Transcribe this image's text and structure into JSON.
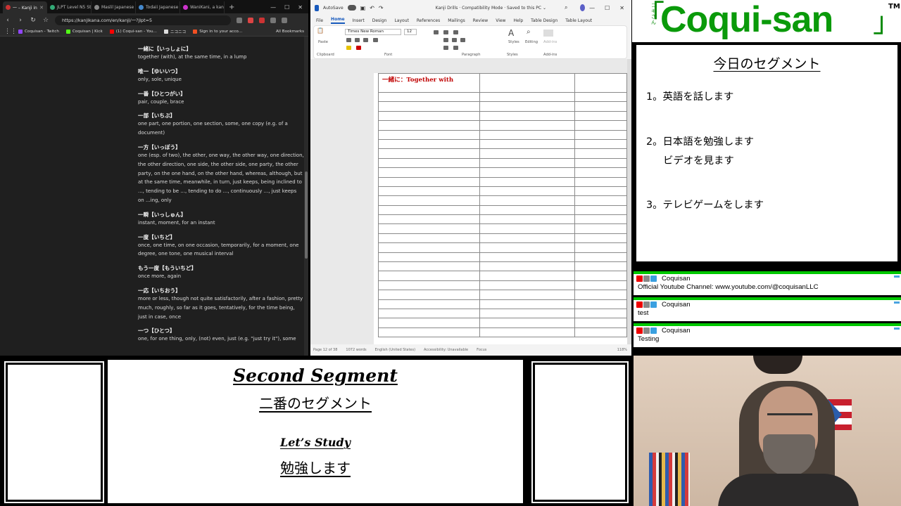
{
  "browser": {
    "tabs": [
      {
        "label": "一 – Kanji in"
      },
      {
        "label": "JLPT Level N5 St"
      },
      {
        "label": "Maslil Japanese"
      },
      {
        "label": "Todaii Japanese"
      },
      {
        "label": "WaniKani, a kan"
      }
    ],
    "url": "https://kanjikana.com/en/kanji/一?jlpt=5",
    "bookmarks": [
      {
        "label": "Coquisan - Twitch"
      },
      {
        "label": "Coquisan | Kick"
      },
      {
        "label": "(1) Coqui-san - You..."
      },
      {
        "label": "ニコニコ"
      },
      {
        "label": "Sign in to your acco..."
      }
    ],
    "all_bookmarks": "All Bookmarks",
    "entries": [
      {
        "word": "一緒に【いっしょに】",
        "meaning": "together (with), at the same time, in a lump"
      },
      {
        "word": "唯一【ゆいいつ】",
        "meaning": "only, sole, unique"
      },
      {
        "word": "一番【ひとつがい】",
        "meaning": "pair, couple, brace"
      },
      {
        "word": "一部【いちぶ】",
        "meaning": "one part, one portion, one section, some, one copy (e.g. of a document)"
      },
      {
        "word": "一方【いっぽう】",
        "meaning": "one (esp. of two), the other, one way, the other way, one direction, the other direction, one side, the other side, one party, the other party, on the one hand, on the other hand, whereas, although, but at the same time, meanwhile, in turn, just keeps, being inclined to ..., tending to be ..., tending to do ..., continuously ..., just keeps on ...ing, only"
      },
      {
        "word": "一瞬【いっしゅん】",
        "meaning": "instant, moment, for an instant"
      },
      {
        "word": "一度【いちど】",
        "meaning": "once, one time, on one occasion, temporarily, for a moment, one degree, one tone, one musical interval"
      },
      {
        "word": "もう一度【もういちど】",
        "meaning": "once more, again"
      },
      {
        "word": "一応【いちおう】",
        "meaning": "more or less, though not quite satisfactorily, after a fashion, pretty much, roughly, so far as it goes, tentatively, for the time being, just in case, once"
      },
      {
        "word": "一つ【ひとつ】",
        "meaning": "one, for one thing, only, (not) even, just (e.g. \"just try it\"), some"
      }
    ]
  },
  "word": {
    "autosave": "AutoSave",
    "title": "Kanji Drills  ·  Compatibility Mode  ·  Saved to this PC ⌄",
    "menu": [
      "File",
      "Home",
      "Insert",
      "Design",
      "Layout",
      "References",
      "Mailings",
      "Review",
      "View",
      "Help",
      "Table Design",
      "Table Layout"
    ],
    "font": "Times New Roman",
    "size": "12",
    "groups": [
      "Clipboard",
      "Font",
      "Paragraph",
      "Styles",
      "Add-ins"
    ],
    "ribbon_labels": [
      "Paste",
      "Styles",
      "Editing",
      "Add-ins"
    ],
    "cell_heading": "一緒に：Together  with",
    "status": [
      "Page 12 of 38",
      "1072 words",
      "English (United States)",
      "Accessibility: Unavailable",
      "Focus"
    ],
    "zoom": "118%"
  },
  "logo": {
    "bracket_left": "「",
    "small": "コキさん",
    "text": "Coqui-san",
    "bracket_right": "」",
    "tm": "TM"
  },
  "segment": {
    "title": "今日のセグメント",
    "items": [
      "1。英語を話します",
      "2。日本語を勉強します",
      "ビデオを見ます",
      "3。テレビゲームをします"
    ]
  },
  "chat": [
    {
      "user": "Coquisan",
      "text": "Official Youtube Channel: www.youtube.com/@coquisanLLC"
    },
    {
      "user": "Coquisan",
      "text": "test"
    },
    {
      "user": "Coquisan",
      "text": "Testing"
    }
  ],
  "bottom": {
    "title": "Second Segment",
    "title_jp": "二番のセグメント",
    "subtitle": "Let’s Study",
    "subtitle_jp": "勉強します"
  },
  "colors": {
    "logo_green": "#0a9a0a",
    "chat_stripe": "#00c800",
    "heading_red": "#c00000",
    "word_blue": "#185abd"
  }
}
